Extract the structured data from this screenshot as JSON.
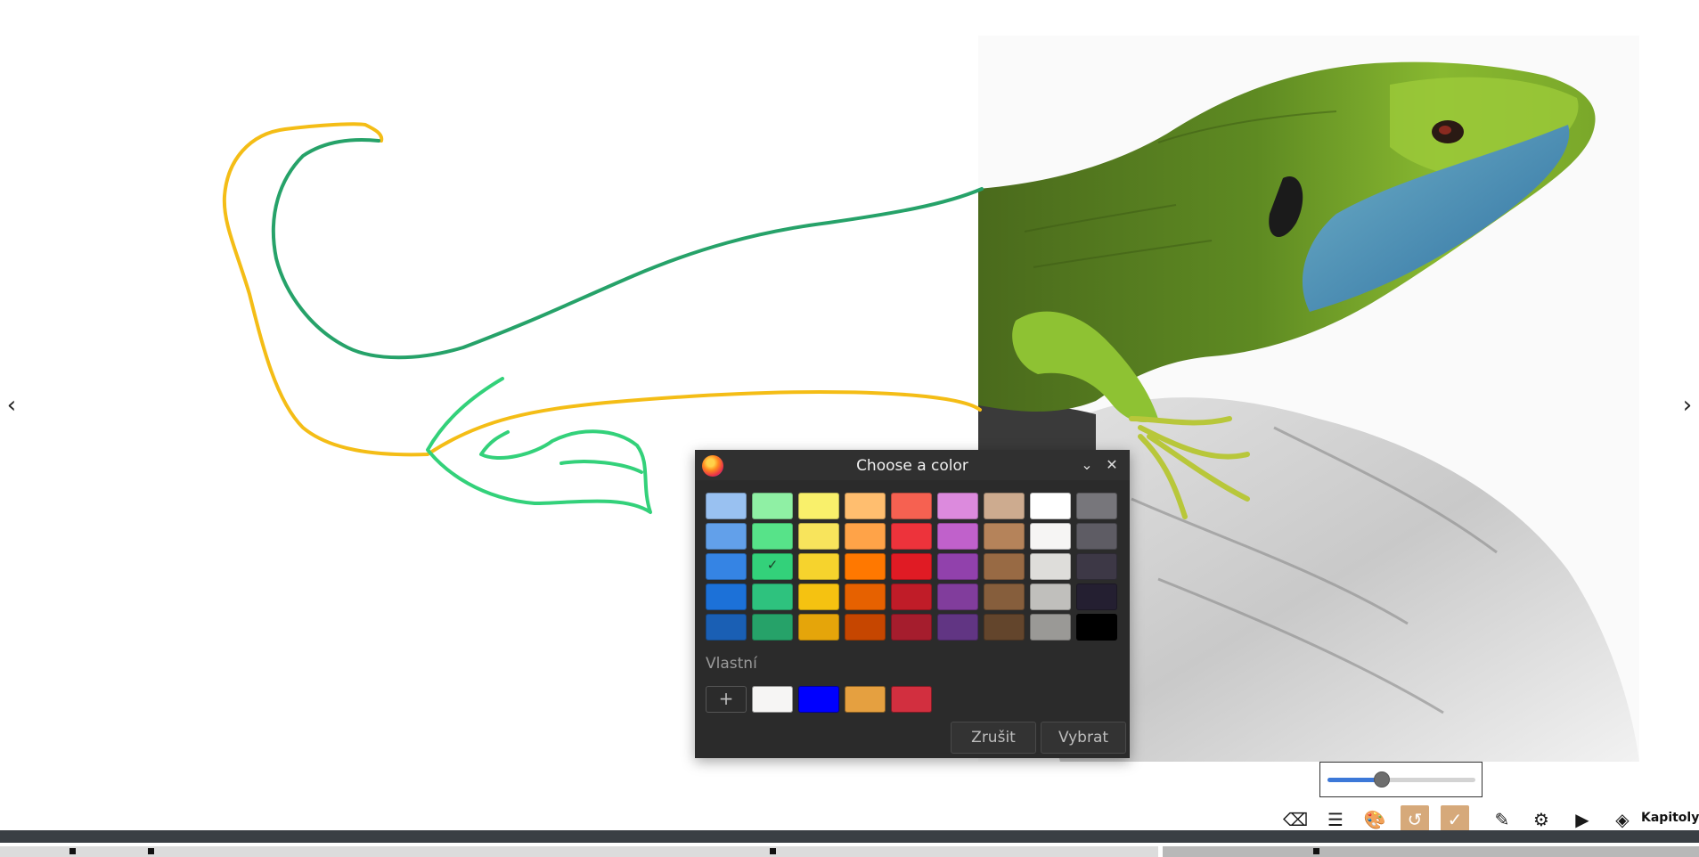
{
  "canvas": {
    "nav_prev": "‹",
    "nav_next": "›"
  },
  "dialog": {
    "title": "Choose a color",
    "minimize_icon": "chevron-down-icon",
    "close_icon": "close-icon",
    "palette": [
      [
        "#99c1f1",
        "#8ff0a4",
        "#f9f06b",
        "#ffbe6f",
        "#f66151",
        "#dc8add",
        "#cdab8f",
        "#ffffff",
        "#77767b"
      ],
      [
        "#62a0ea",
        "#57e389",
        "#f8e45c",
        "#ffa348",
        "#ed333b",
        "#c061cb",
        "#b5835a",
        "#f6f5f4",
        "#5e5c64"
      ],
      [
        "#3584e4",
        "#33d17a",
        "#f6d32d",
        "#ff7800",
        "#e01b24",
        "#9141ac",
        "#986a44",
        "#deddda",
        "#3d3846"
      ],
      [
        "#1c71d8",
        "#2ec27e",
        "#f5c211",
        "#e66100",
        "#c01c28",
        "#813d9c",
        "#865e3c",
        "#c0bfbc",
        "#241f31"
      ],
      [
        "#1a5fb4",
        "#26a269",
        "#e5a50a",
        "#c64600",
        "#a51d2d",
        "#613583",
        "#63452c",
        "#9a9996",
        "#000000"
      ]
    ],
    "selected": {
      "row": 2,
      "col": 1,
      "mark": "✓"
    },
    "custom_label": "Vlastní",
    "add_label": "+",
    "custom_colors": [
      "#f6f5f4",
      "#0000ff",
      "#e5a040",
      "#d22f3f"
    ],
    "cancel_label": "Zrušit",
    "select_label": "Vybrat"
  },
  "slider": {
    "value_fraction": 0.37,
    "accent": "#3c78d8"
  },
  "toolbar": {
    "items": [
      {
        "name": "eraser-button",
        "icon": "eraser-icon",
        "glyph": "⌫"
      },
      {
        "name": "menu-button",
        "icon": "menu-icon",
        "glyph": "☰"
      },
      {
        "name": "palette-button",
        "icon": "palette-icon",
        "glyph": "🎨"
      },
      {
        "name": "undo-button",
        "icon": "undo-icon",
        "glyph": "↺",
        "active": true
      },
      {
        "name": "confirm-button",
        "icon": "check-icon",
        "glyph": "✓",
        "active": true
      },
      {
        "name": "pen-button",
        "icon": "pencil-icon",
        "glyph": "✎"
      },
      {
        "name": "settings-button",
        "icon": "gear-icon",
        "glyph": "⚙"
      },
      {
        "name": "play-button",
        "icon": "play-icon",
        "glyph": "▶"
      },
      {
        "name": "chapters-button",
        "icon": "layers-icon",
        "glyph": "◈"
      }
    ],
    "chapters_label": "Kapitoly",
    "active_color": "#d6a97a"
  },
  "timeline": {
    "bar_color": "#3a3f44",
    "segment_color": "#dcdcdc"
  }
}
